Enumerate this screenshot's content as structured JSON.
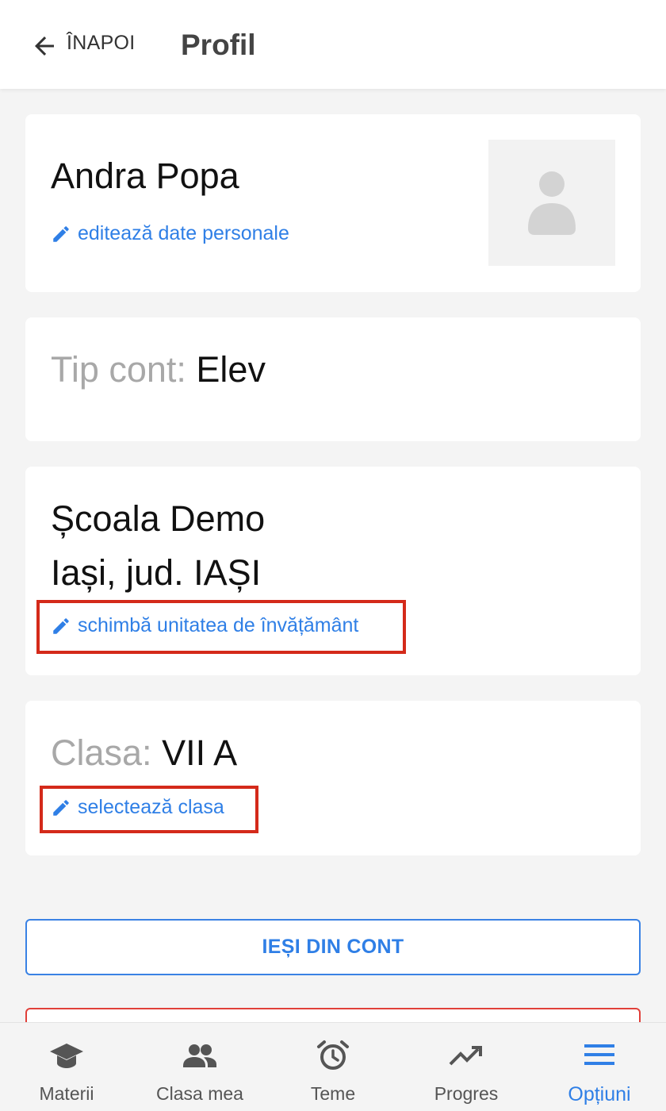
{
  "header": {
    "back_label": "ÎNAPOI",
    "title": "Profil"
  },
  "profile": {
    "name": "Andra Popa",
    "edit_personal_label": "editează date personale"
  },
  "account": {
    "type_label": "Tip cont:",
    "type_value": "Elev"
  },
  "school": {
    "name": "Școala Demo",
    "location": "Iași, jud. IAȘI",
    "change_label": "schimbă unitatea de învățământ"
  },
  "class": {
    "label": "Clasa:",
    "value": "VII A",
    "select_label": "selectează clasa"
  },
  "actions": {
    "logout_label": "IEȘI DIN CONT"
  },
  "tabbar": {
    "items": [
      {
        "label": "Materii",
        "icon": "graduation-cap-icon",
        "active": false
      },
      {
        "label": "Clasa mea",
        "icon": "people-icon",
        "active": false
      },
      {
        "label": "Teme",
        "icon": "alarm-clock-icon",
        "active": false
      },
      {
        "label": "Progres",
        "icon": "trending-up-icon",
        "active": false
      },
      {
        "label": "Opțiuni",
        "icon": "menu-icon",
        "active": true
      }
    ]
  },
  "colors": {
    "accent": "#2f7fe6",
    "highlight": "#d42a1a",
    "background": "#f4f4f4",
    "muted": "#a8a8a8"
  }
}
